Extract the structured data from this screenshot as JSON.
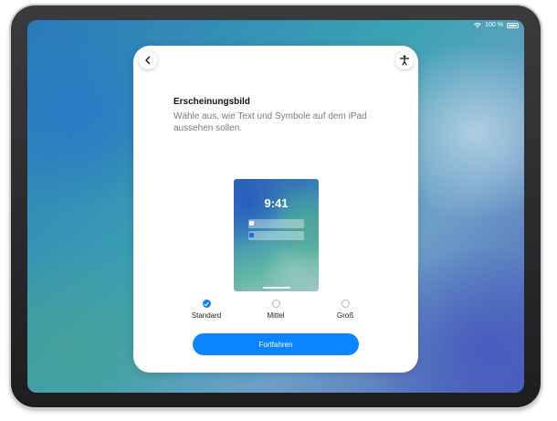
{
  "status_bar": {
    "battery_label": "100 %",
    "icons": [
      "wifi-icon",
      "battery-icon"
    ]
  },
  "card": {
    "back_icon": "chevron-left-icon",
    "accessibility_icon": "accessibility-icon",
    "title": "Erscheinungsbild",
    "subtitle": "Wähle aus, wie Text und Symbole auf dem iPad aussehen sollen.",
    "preview_time": "9:41",
    "options": [
      {
        "label": "Standard",
        "selected": true
      },
      {
        "label": "Mittel",
        "selected": false
      },
      {
        "label": "Groß",
        "selected": false
      }
    ],
    "continue_label": "Fortfahren"
  },
  "colors": {
    "accent": "#0a84ff",
    "card_bg": "#ffffff",
    "subtitle_text": "#7a7a7e"
  }
}
